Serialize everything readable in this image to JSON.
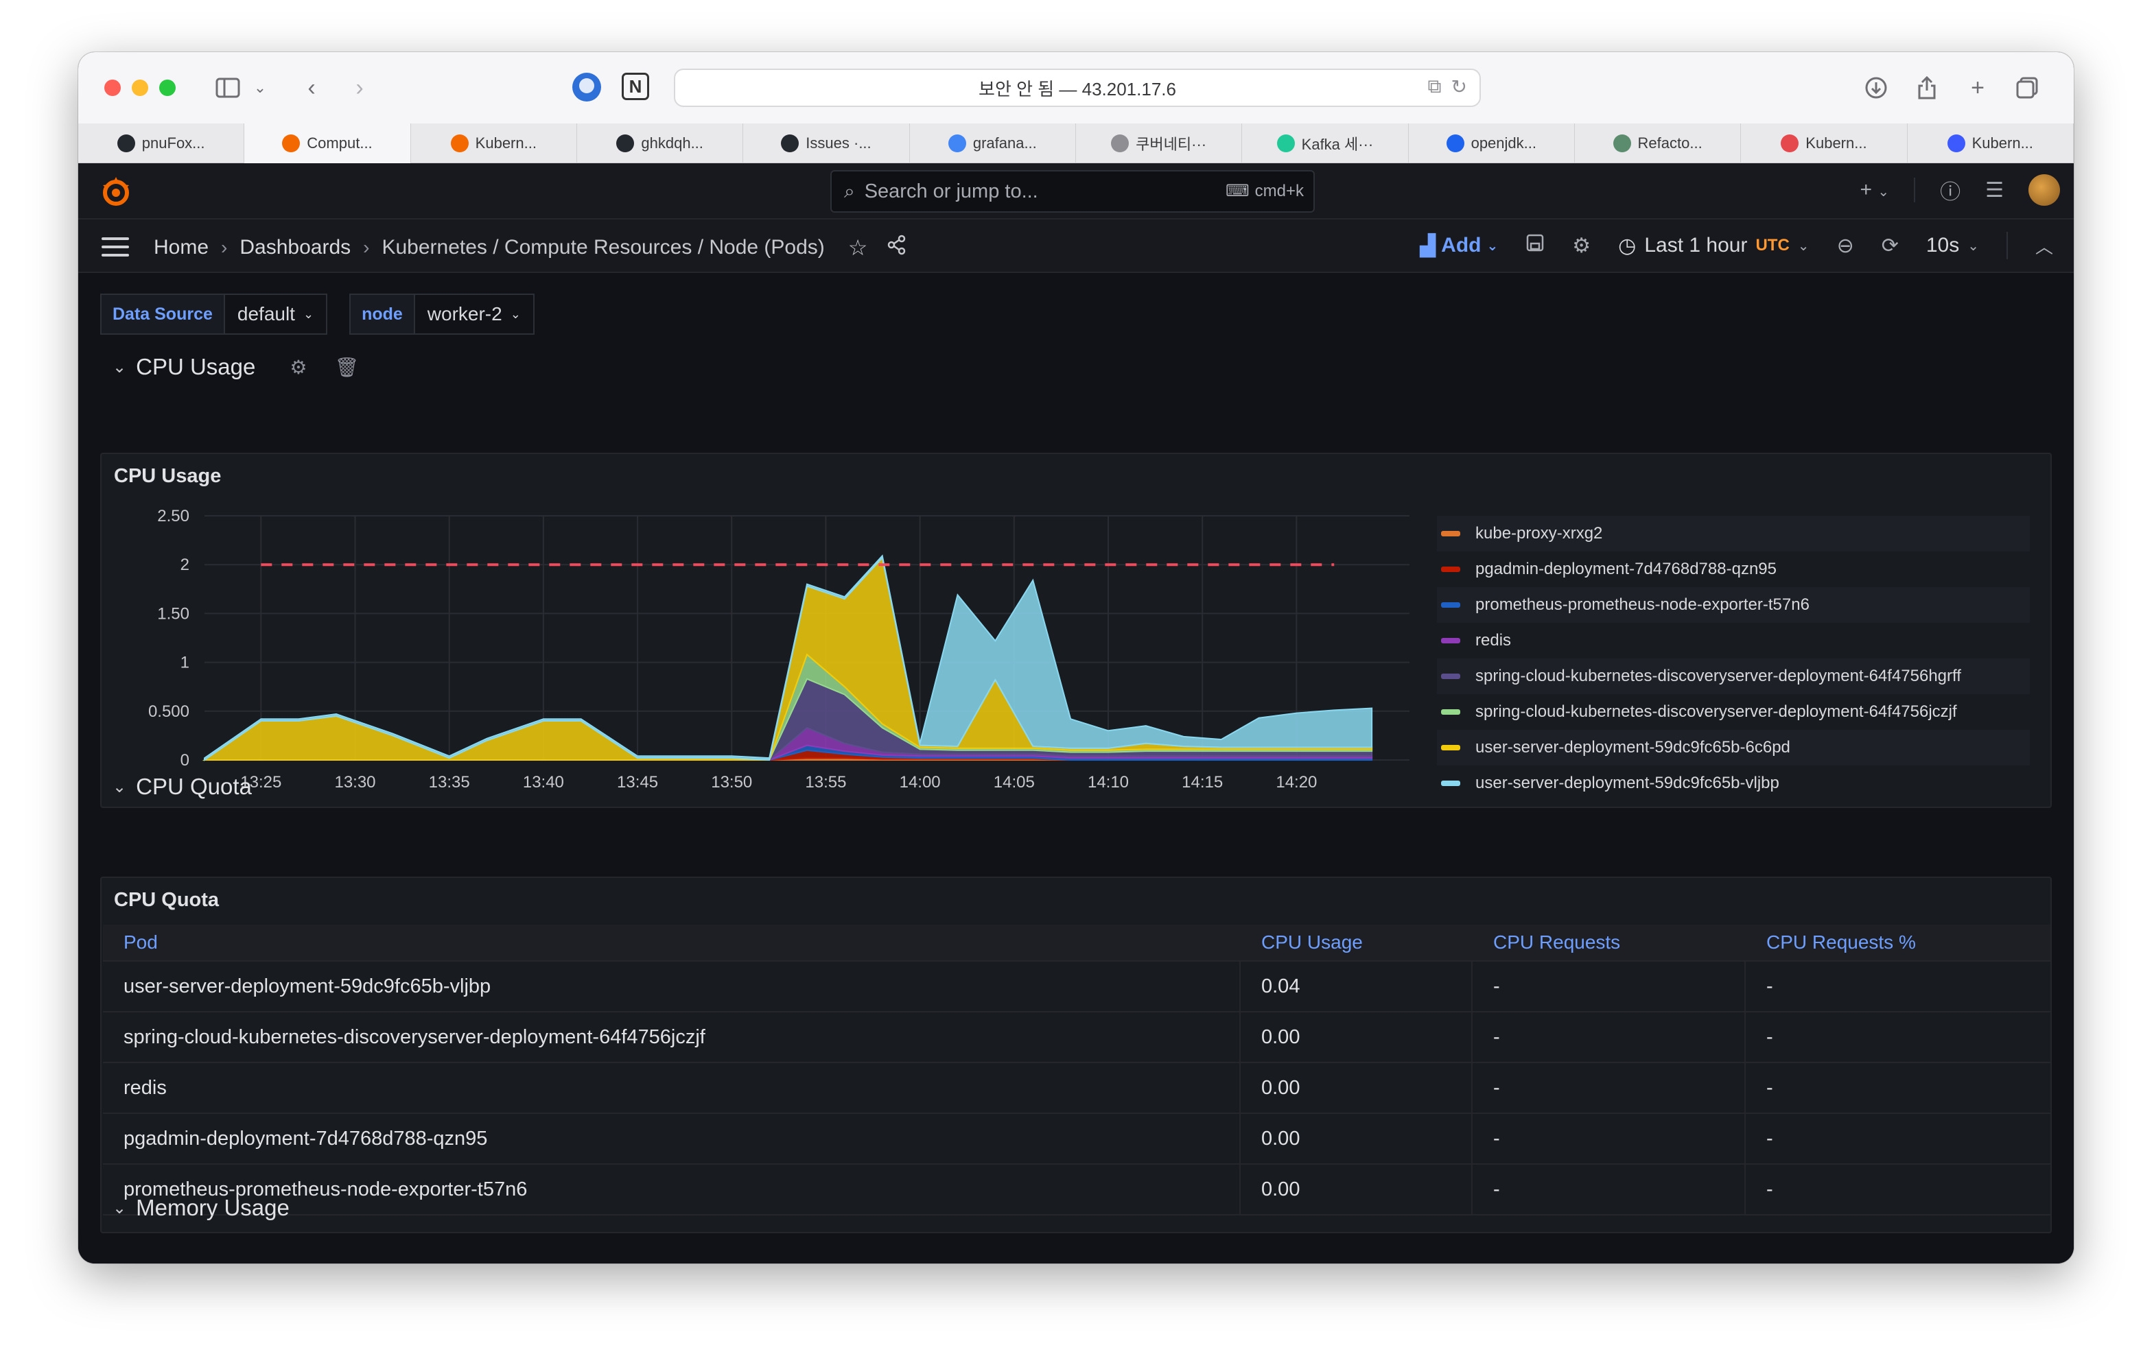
{
  "browser": {
    "address_text": "보안 안 됨 — 43.201.17.6",
    "tabs": [
      {
        "label": "pnuFox...",
        "icon": "github-icon",
        "color": "#24292f"
      },
      {
        "label": "Comput...",
        "icon": "grafana-icon",
        "color": "#f46800",
        "active": true
      },
      {
        "label": "Kubern...",
        "icon": "grafana-icon",
        "color": "#f46800"
      },
      {
        "label": "ghkdqh...",
        "icon": "github-icon",
        "color": "#24292f"
      },
      {
        "label": "Issues ·...",
        "icon": "github-icon",
        "color": "#24292f"
      },
      {
        "label": "grafana...",
        "icon": "google-icon",
        "color": "#4285f4"
      },
      {
        "label": "쿠버네티···",
        "icon": "tistory-icon",
        "color": "#8e8e93"
      },
      {
        "label": "Kafka 세···",
        "icon": "velog-icon",
        "color": "#20c997"
      },
      {
        "label": "openjdk...",
        "icon": "docker-icon",
        "color": "#1d63ed"
      },
      {
        "label": "Refacto...",
        "icon": "refactoring-icon",
        "color": "#5b8c6e"
      },
      {
        "label": "Kubern...",
        "icon": "kubernetes-icon",
        "color": "#e5484d"
      },
      {
        "label": "Kubern...",
        "icon": "terminal-icon",
        "color": "#3d5afe"
      }
    ]
  },
  "grafana": {
    "search_placeholder": "Search or jump to...",
    "search_shortcut": "cmd+k",
    "breadcrumbs": [
      "Home",
      "Dashboards",
      "Kubernetes / Compute Resources / Node (Pods)"
    ],
    "add_label": "Add",
    "time_range": "Last 1 hour",
    "timezone": "UTC",
    "refresh": "10s",
    "variables": [
      {
        "label": "Data Source",
        "value": "default"
      },
      {
        "label": "node",
        "value": "worker-2"
      }
    ],
    "rows": {
      "cpu_usage": "CPU Usage",
      "cpu_quota": "CPU Quota",
      "memory_usage": "Memory Usage"
    },
    "panels": {
      "cpu_usage_title": "CPU Usage",
      "cpu_quota_title": "CPU Quota"
    },
    "table": {
      "headers": [
        "Pod",
        "CPU Usage",
        "CPU Requests",
        "CPU Requests %"
      ],
      "rows": [
        [
          "user-server-deployment-59dc9fc65b-vljbp",
          "0.04",
          "-",
          "-"
        ],
        [
          "spring-cloud-kubernetes-discoveryserver-deployment-64f4756jczjf",
          "0.00",
          "-",
          "-"
        ],
        [
          "redis",
          "0.00",
          "-",
          "-"
        ],
        [
          "pgadmin-deployment-7d4768d788-qzn95",
          "0.00",
          "-",
          "-"
        ],
        [
          "prometheus-prometheus-node-exporter-t57n6",
          "0.00",
          "-",
          "-"
        ]
      ]
    }
  },
  "chart_data": {
    "type": "area",
    "title": "CPU Usage",
    "stacked": true,
    "x": [
      "13:22",
      "13:25",
      "13:27",
      "13:29",
      "13:32",
      "13:35",
      "13:37",
      "13:40",
      "13:42",
      "13:45",
      "13:50",
      "13:52",
      "13:54",
      "13:56",
      "13:58",
      "14:00",
      "14:02",
      "14:04",
      "14:06",
      "14:08",
      "14:10",
      "14:12",
      "14:14",
      "14:16",
      "14:18",
      "14:20",
      "14:22",
      "14:24"
    ],
    "x_ticks": [
      "13:25",
      "13:30",
      "13:35",
      "13:40",
      "13:45",
      "13:50",
      "13:55",
      "14:00",
      "14:05",
      "14:10",
      "14:15",
      "14:20"
    ],
    "y_ticks": [
      "0",
      "0.500",
      "1",
      "1.50",
      "2",
      "2.50"
    ],
    "ylim": [
      0,
      2.5
    ],
    "threshold": {
      "value": 2,
      "style": "dashed",
      "color": "#f2495c"
    },
    "legend_placement": "right",
    "series": [
      {
        "name": "kube-proxy-xrxg2",
        "color": "#e0752d",
        "values": [
          0,
          0,
          0,
          0,
          0,
          0,
          0,
          0,
          0,
          0,
          0,
          0,
          0.02,
          0.02,
          0.01,
          0.01,
          0.01,
          0.01,
          0.01,
          0,
          0,
          0,
          0,
          0,
          0,
          0,
          0,
          0
        ]
      },
      {
        "name": "pgadmin-deployment-7d4768d788-qzn95",
        "color": "#bf1b00",
        "values": [
          0,
          0,
          0,
          0,
          0,
          0,
          0,
          0,
          0,
          0,
          0,
          0,
          0.08,
          0.04,
          0.02,
          0.01,
          0.01,
          0.01,
          0.01,
          0,
          0,
          0,
          0,
          0,
          0,
          0,
          0,
          0
        ]
      },
      {
        "name": "prometheus-prometheus-node-exporter-t57n6",
        "color": "#1f60c4",
        "values": [
          0,
          0,
          0,
          0,
          0,
          0,
          0,
          0,
          0,
          0,
          0,
          0,
          0.05,
          0.03,
          0.02,
          0.02,
          0.02,
          0.02,
          0.02,
          0.02,
          0.02,
          0.02,
          0.02,
          0.02,
          0.02,
          0.02,
          0.02,
          0.02
        ]
      },
      {
        "name": "redis",
        "color": "#8f3bb8",
        "values": [
          0,
          0,
          0,
          0,
          0,
          0,
          0,
          0,
          0,
          0,
          0,
          0,
          0.18,
          0.08,
          0.03,
          0.02,
          0.02,
          0.02,
          0.02,
          0.02,
          0.02,
          0.02,
          0.02,
          0.02,
          0.02,
          0.02,
          0.02,
          0.02
        ]
      },
      {
        "name": "spring-cloud-kubernetes-discoveryserver-deployment-64f4756hgrff",
        "color": "#5a4f8c",
        "values": [
          0,
          0,
          0,
          0,
          0,
          0,
          0,
          0,
          0,
          0,
          0,
          0,
          0.5,
          0.5,
          0.25,
          0.05,
          0.04,
          0.04,
          0.04,
          0.04,
          0.04,
          0.05,
          0.05,
          0.05,
          0.05,
          0.05,
          0.05,
          0.05
        ]
      },
      {
        "name": "spring-cloud-kubernetes-discoveryserver-deployment-64f4756jczjf",
        "color": "#96d98d",
        "values": [
          0,
          0,
          0,
          0,
          0,
          0,
          0,
          0,
          0,
          0,
          0,
          0,
          0.25,
          0.08,
          0.04,
          0.02,
          0.02,
          0.02,
          0.02,
          0.02,
          0.02,
          0.02,
          0.02,
          0.02,
          0.02,
          0.02,
          0.02,
          0.02
        ]
      },
      {
        "name": "user-server-deployment-59dc9fc65b-6c6pd",
        "color": "#f2cc0c",
        "values": [
          0,
          0.4,
          0.4,
          0.45,
          0.25,
          0.02,
          0.2,
          0.4,
          0.4,
          0.02,
          0.02,
          0,
          0.7,
          0.9,
          1.7,
          0.02,
          0.02,
          0.7,
          0.02,
          0.02,
          0.02,
          0.06,
          0.03,
          0.02,
          0.02,
          0.02,
          0.02,
          0.02
        ]
      },
      {
        "name": "user-server-deployment-59dc9fc65b-vljbp",
        "color": "#8ad8f0",
        "values": [
          0.02,
          0.02,
          0.02,
          0.02,
          0.02,
          0.02,
          0.02,
          0.02,
          0.02,
          0.02,
          0.02,
          0.02,
          0.02,
          0.02,
          0.02,
          0.02,
          1.55,
          0.4,
          1.7,
          0.3,
          0.18,
          0.18,
          0.1,
          0.08,
          0.3,
          0.35,
          0.38,
          0.4
        ]
      }
    ]
  }
}
